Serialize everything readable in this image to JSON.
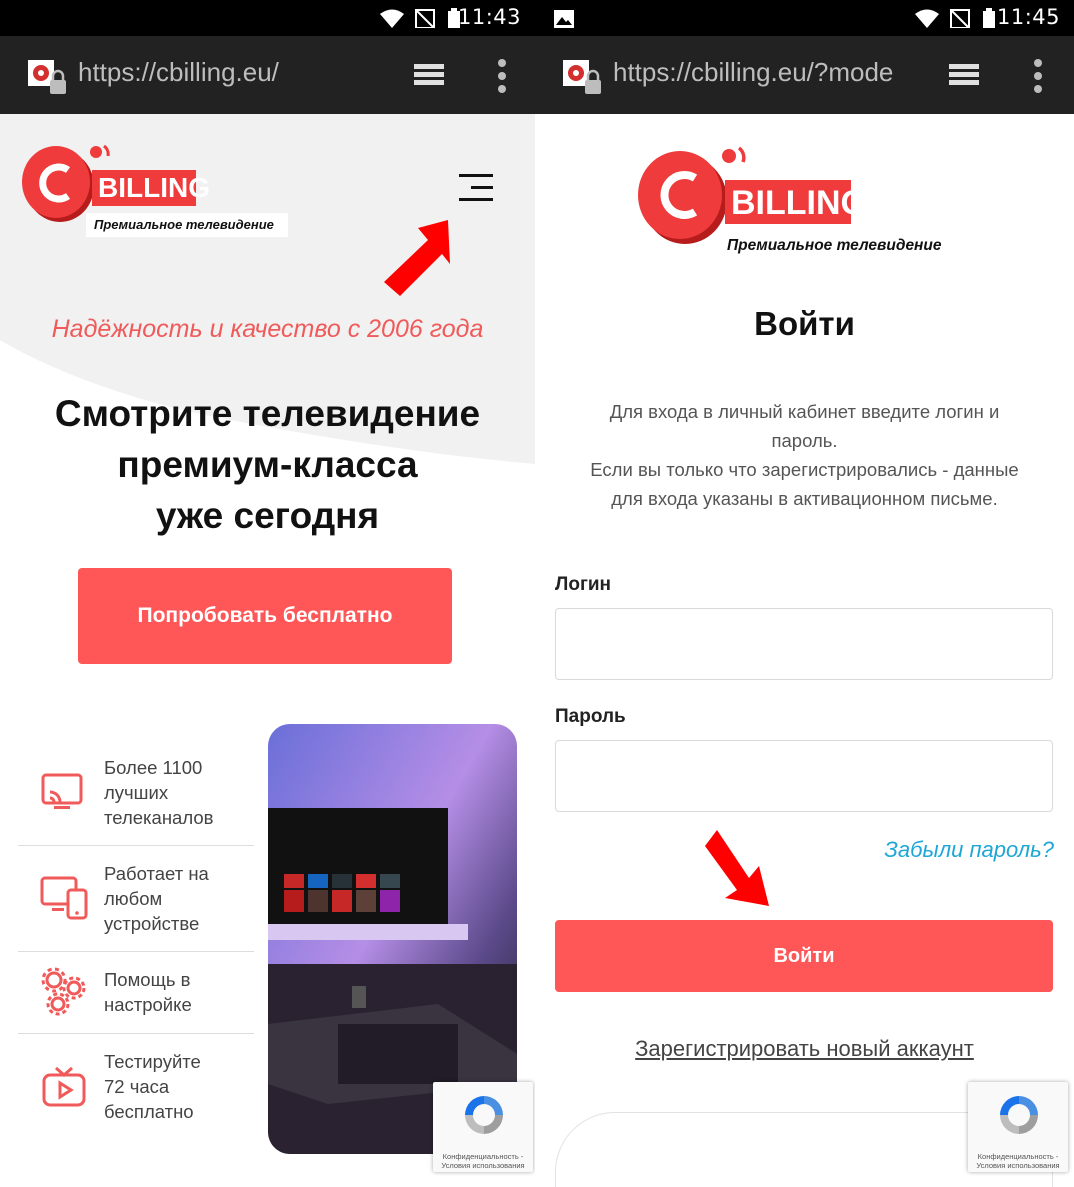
{
  "left": {
    "status": {
      "time": "11:43"
    },
    "browser": {
      "url": "https://cbilling.eu/"
    },
    "logo": {
      "brand": "BILLING",
      "subtitle": "Премиальное телевидение"
    },
    "tagline": "Надёжность и качество с 2006 года",
    "headline": [
      "Смотрите телевидение",
      "премиум-класса",
      "уже сегодня"
    ],
    "cta_label": "Попробовать бесплатно",
    "features": [
      {
        "icon": "cast-tv-icon",
        "lines": [
          "Более 1100",
          "лучших",
          "телеканалов"
        ]
      },
      {
        "icon": "devices-icon",
        "lines": [
          "Работает на",
          "любом",
          "устройстве"
        ]
      },
      {
        "icon": "gears-icon",
        "lines": [
          "Помощь в",
          "настройке"
        ]
      },
      {
        "icon": "tv-play-icon",
        "lines": [
          "Тестируйте",
          "72 часа",
          "бесплатно"
        ]
      }
    ],
    "recaptcha_text": [
      "Конфиденциальность -",
      "Условия использования"
    ]
  },
  "right": {
    "status": {
      "time": "11:45"
    },
    "browser": {
      "url": "https://cbilling.eu/?mode"
    },
    "logo": {
      "brand": "BILLING",
      "subtitle": "Премиальное телевидение"
    },
    "title": "Войти",
    "info": [
      "Для входа в личный кабинет введите логин и",
      "пароль.",
      "Если вы только что зарегистрировались - данные",
      "для входа указаны в активационном письме."
    ],
    "login_label": "Логин",
    "password_label": "Пароль",
    "login_value": "",
    "password_value": "",
    "forgot_label": "Забыли пароль?",
    "submit_label": "Войти",
    "register_label": "Зарегистрировать новый аккаунт",
    "recaptcha_text": [
      "Конфиденциальность -",
      "Условия использования"
    ]
  },
  "colors": {
    "accent": "#ff5757",
    "link": "#1ea7d6",
    "arrow": "#ff0000"
  }
}
